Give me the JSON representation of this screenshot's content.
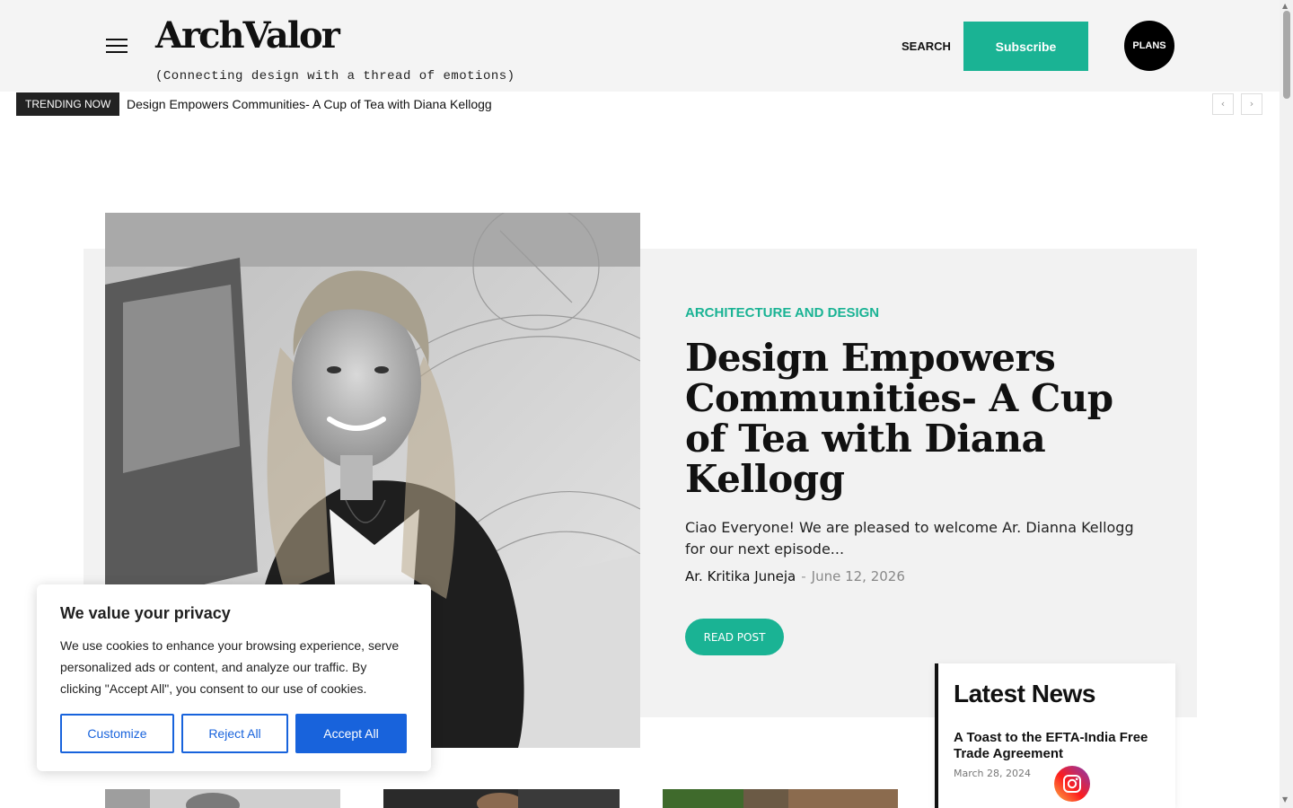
{
  "header": {
    "logo": "ArchValor",
    "tagline": "(Connecting design with a thread of emotions)",
    "search_label": "SEARCH",
    "subscribe_label": "Subscribe",
    "plans_label": "PLANS"
  },
  "trending": {
    "label": "TRENDING NOW",
    "title": "Design Empowers Communities- A Cup of Tea with Diana Kellogg",
    "prev_icon": "‹",
    "next_icon": "›"
  },
  "hero": {
    "category": "ARCHITECTURE AND DESIGN",
    "headline": "Design Empowers Communities- A Cup of Tea with Diana Kellogg",
    "excerpt": "Ciao Everyone! We are pleased to welcome Ar. Dianna Kellogg for our next episode...",
    "author": "Ar. Kritika Juneja",
    "separator": "-",
    "date": "June 12, 2026",
    "read_label": "READ POST"
  },
  "latest_news": {
    "title": "Latest News",
    "items": [
      {
        "title": "A Toast to the EFTA-India Free Trade Agreement",
        "date": "March 28, 2024"
      }
    ]
  },
  "cookie_banner": {
    "title": "We value your privacy",
    "text": "We use cookies to enhance your browsing experience, serve personalized ads or content, and analyze our traffic. By clicking \"Accept All\", you consent to our use of cookies.",
    "customize_label": "Customize",
    "reject_label": "Reject All",
    "accept_label": "Accept All"
  },
  "colors": {
    "accent": "#1ab394",
    "cookie_blue": "#1863dc",
    "header_bg": "#f4f4f4"
  },
  "icons": {
    "menu": "hamburger-icon",
    "social": "instagram-icon"
  }
}
